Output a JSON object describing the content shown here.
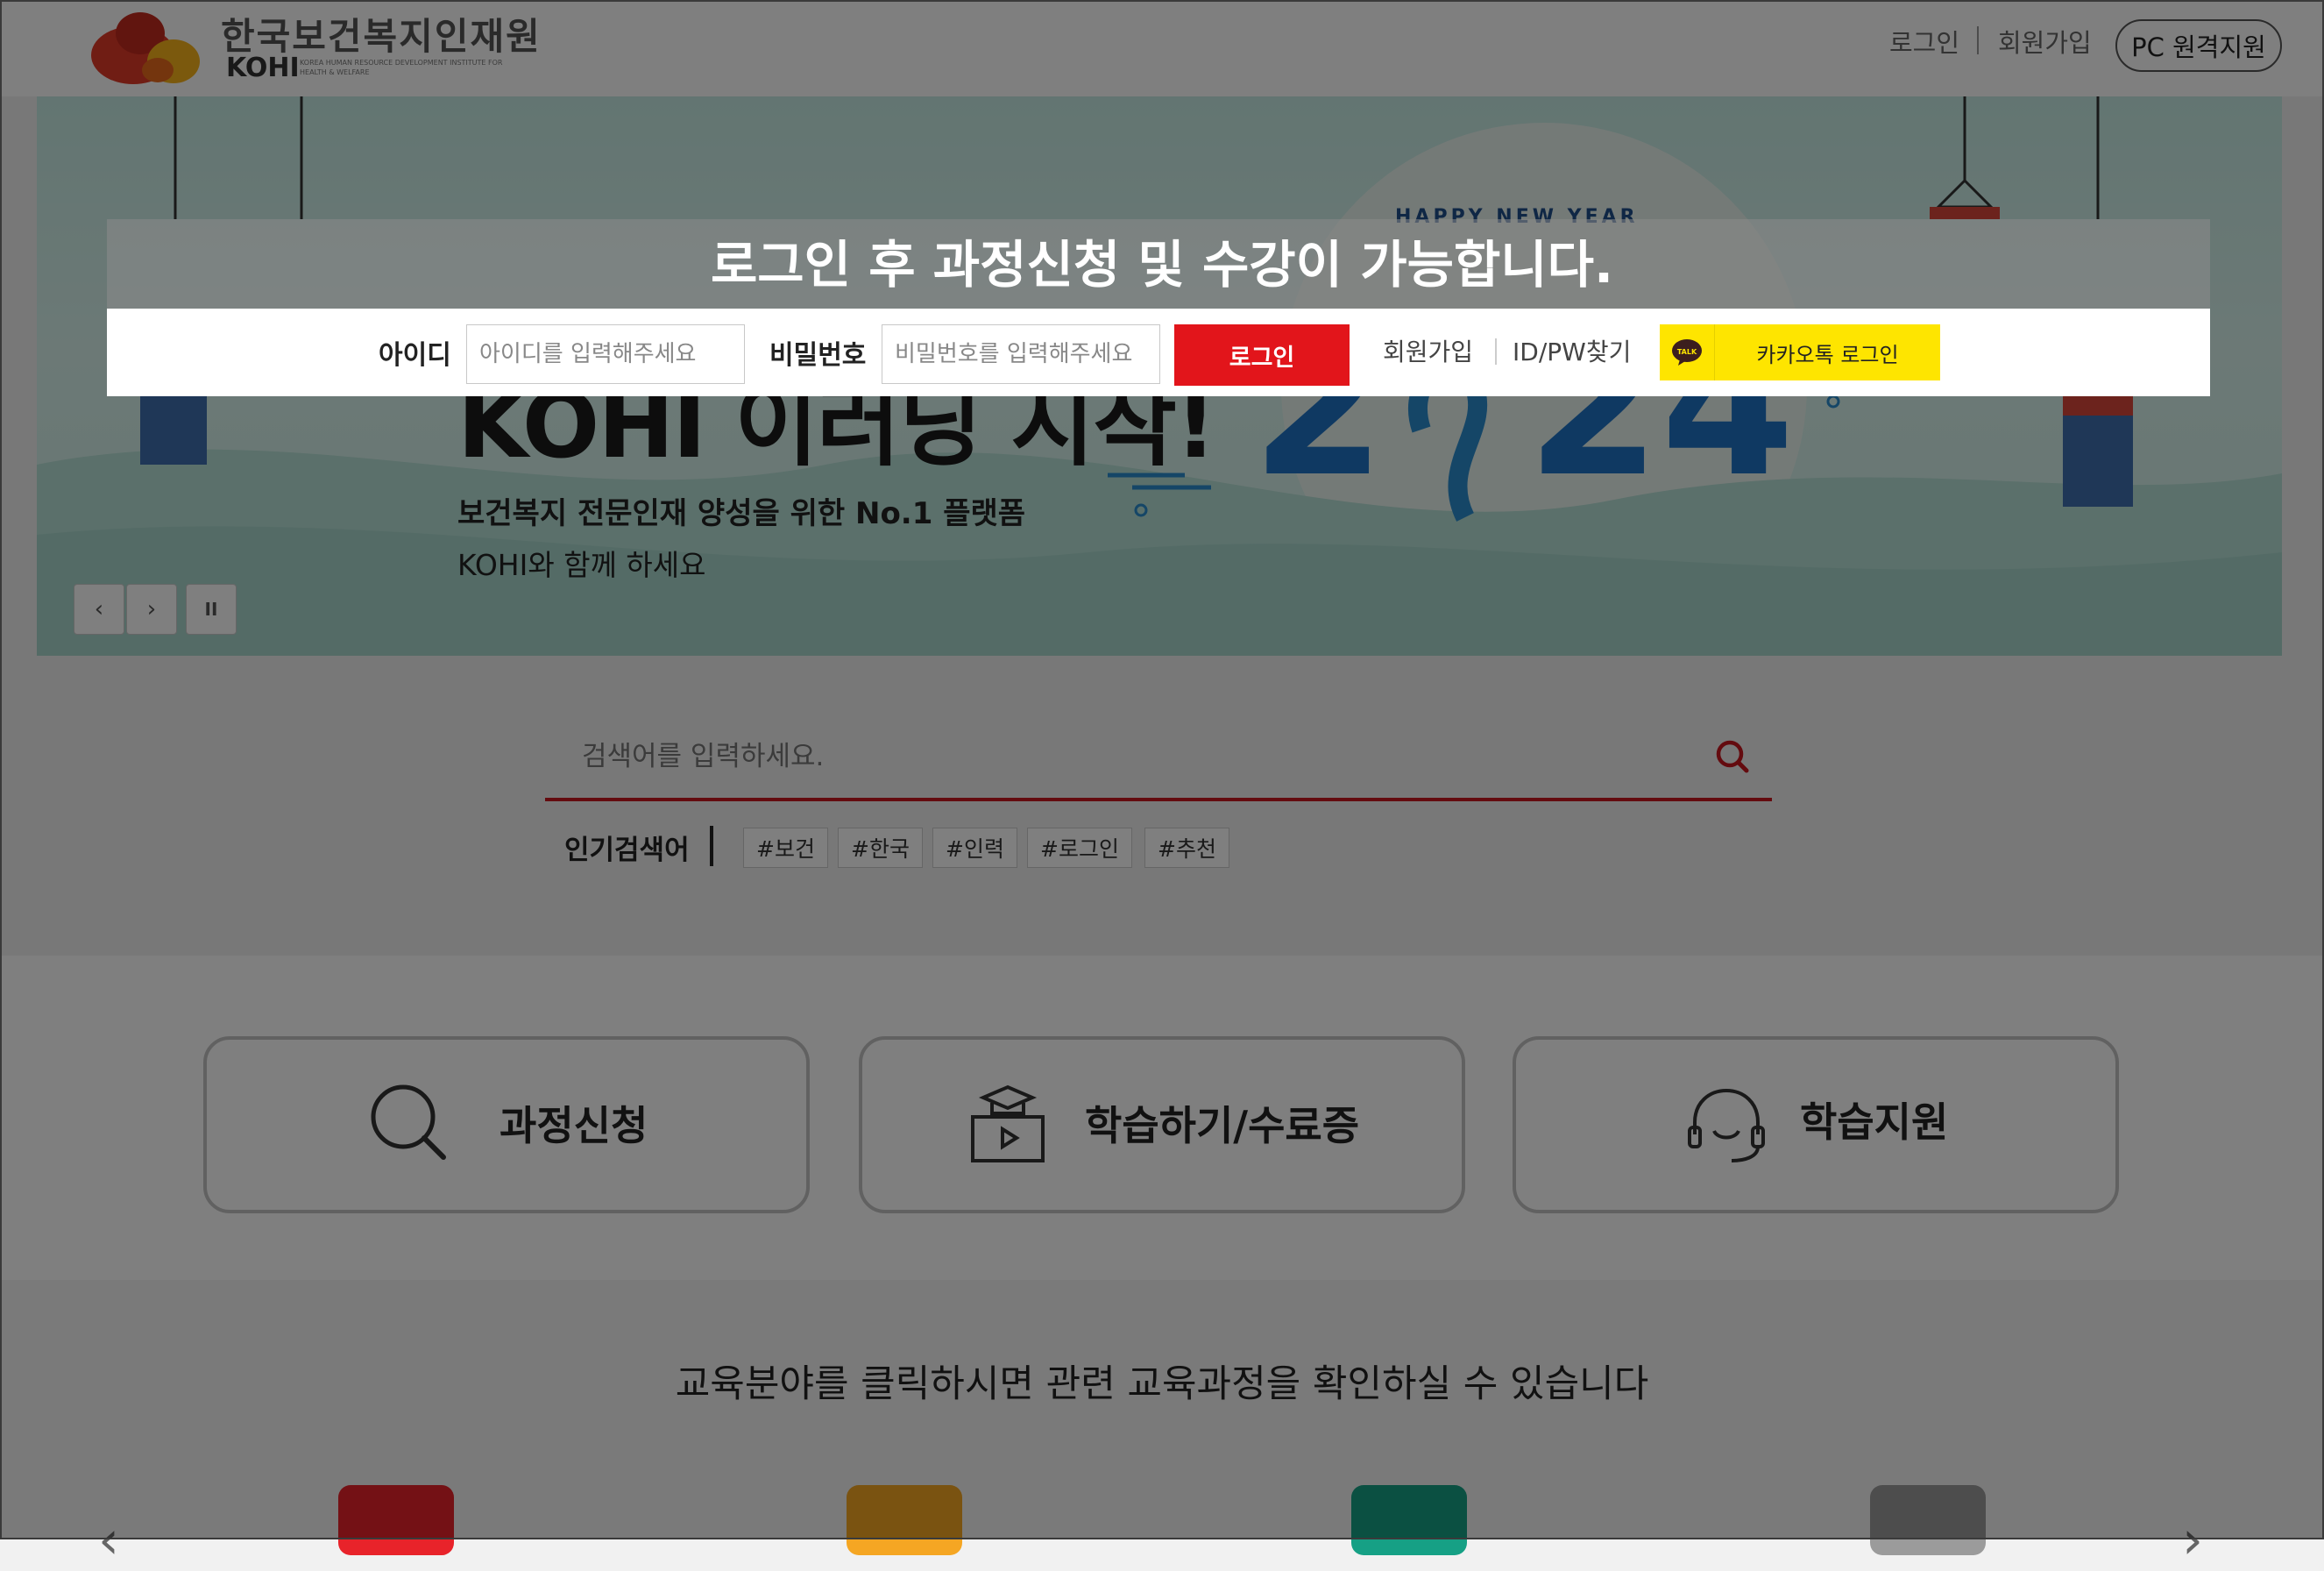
{
  "header": {
    "logo_title": "한국보건복지인재원",
    "logo_sub": "KOHI",
    "logo_eng": "KOREA HUMAN RESOURCE DEVELOPMENT INSTITUTE FOR HEALTH & WELFARE",
    "login_link": "로그인",
    "join_link": "회원가입",
    "pc_remote": "PC 원격지원"
  },
  "hero": {
    "title": "KOHI 이러닝 시작!",
    "subtitle": "보건복지 전문인재 양성을 위한 No.1 플랫폼",
    "subtitle2": "KOHI와 함께 하세요",
    "badge": "HAPPY NEW YEAR",
    "prev_icon": "‹",
    "next_icon": "›",
    "pause_icon": "II"
  },
  "login_overlay": {
    "notice": "로그인 후 과정신청 및 수강이 가능합니다.",
    "id_label": "아이디",
    "id_placeholder": "아이디를 입력해주세요",
    "pw_label": "비밀번호",
    "pw_placeholder": "비밀번호를 입력해주세요",
    "login_button": "로그인",
    "join_link": "회원가입",
    "find_link": "ID/PW찾기",
    "kakao_button": "카카오톡 로그인",
    "kakao_icon_text": "TALK"
  },
  "search": {
    "placeholder": "검색어를 입력하세요.",
    "popular_label": "인기검색어",
    "tags": [
      "#보건",
      "#한국",
      "#인력",
      "#로그인",
      "#추천"
    ]
  },
  "quick_menu": [
    {
      "label": "과정신청",
      "icon": "search-icon"
    },
    {
      "label": "학습하기/수료증",
      "icon": "graduation-video-icon"
    },
    {
      "label": "학습지원",
      "icon": "headset-icon"
    }
  ],
  "field": {
    "description": "교육분야를 클릭하시면 관련 교육과정을 확인하실 수 있습니다",
    "colors": [
      "#e8232a",
      "#f5a623",
      "#16a085",
      "#9b9b9b"
    ]
  },
  "colors": {
    "accent_red": "#e2151b",
    "kakao_yellow": "#fee500"
  }
}
